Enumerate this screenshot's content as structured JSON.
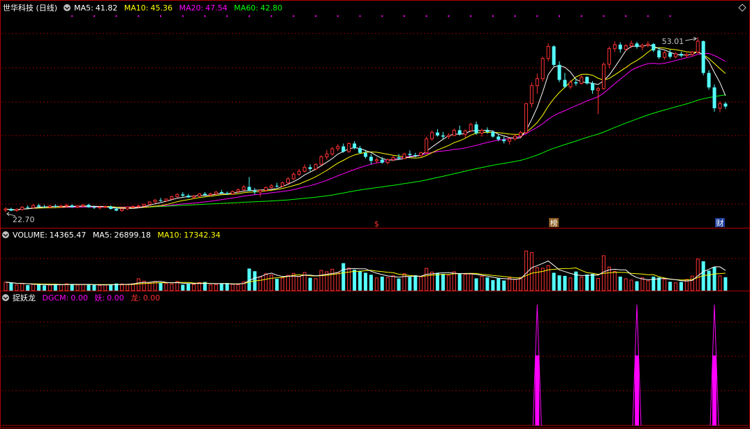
{
  "chart_data": [
    {
      "type": "candlestick",
      "panel": "price",
      "title": "世华科技 (日线)",
      "indicators": [
        {
          "label": "MA5:",
          "value": "41.82",
          "color": "#ffffff"
        },
        {
          "label": "MA10:",
          "value": "45.36",
          "color": "#ffff00"
        },
        {
          "label": "MA20:",
          "value": "47.54",
          "color": "#ff00ff"
        },
        {
          "label": "MA60:",
          "value": "42.80",
          "color": "#00ff00"
        }
      ],
      "ylim": [
        21,
        57
      ],
      "high_label": "53.01",
      "low_label": "22.70",
      "x_marks": [
        "$",
        "榜",
        "财"
      ],
      "candles": [
        [
          23.1,
          23.6,
          22.7,
          23.3
        ],
        [
          23.3,
          23.5,
          22.9,
          23.0
        ],
        [
          23.0,
          23.4,
          22.8,
          23.2
        ],
        [
          23.2,
          23.8,
          23.0,
          23.6
        ],
        [
          23.6,
          23.9,
          23.3,
          23.5
        ],
        [
          23.5,
          24.1,
          23.4,
          23.9
        ],
        [
          23.9,
          24.2,
          23.5,
          23.7
        ],
        [
          23.7,
          24.0,
          23.4,
          23.6
        ],
        [
          23.6,
          24.0,
          23.4,
          23.8
        ],
        [
          23.8,
          24.1,
          23.5,
          23.7
        ],
        [
          23.7,
          24.0,
          23.5,
          23.8
        ],
        [
          23.8,
          24.2,
          23.6,
          23.9
        ],
        [
          23.9,
          24.1,
          23.5,
          23.6
        ],
        [
          23.6,
          24.0,
          23.4,
          23.8
        ],
        [
          23.8,
          24.1,
          23.6,
          24.0
        ],
        [
          24.0,
          24.2,
          23.5,
          23.6
        ],
        [
          23.6,
          23.9,
          23.3,
          23.5
        ],
        [
          23.5,
          23.8,
          23.2,
          23.6
        ],
        [
          23.6,
          23.9,
          23.4,
          23.7
        ],
        [
          23.7,
          23.9,
          23.2,
          23.3
        ],
        [
          23.3,
          23.6,
          22.9,
          23.0
        ],
        [
          23.0,
          23.4,
          22.8,
          23.3
        ],
        [
          23.3,
          23.7,
          23.1,
          23.6
        ],
        [
          23.6,
          23.9,
          23.4,
          23.7
        ],
        [
          23.7,
          24.0,
          23.5,
          23.8
        ],
        [
          23.8,
          24.2,
          23.7,
          24.1
        ],
        [
          24.1,
          24.6,
          24.0,
          24.5
        ],
        [
          24.5,
          25.0,
          24.3,
          24.8
        ],
        [
          24.8,
          25.2,
          24.5,
          24.7
        ],
        [
          24.7,
          25.1,
          24.5,
          25.0
        ],
        [
          25.0,
          25.6,
          24.9,
          25.4
        ],
        [
          25.4,
          26.0,
          25.2,
          25.8
        ],
        [
          25.8,
          26.2,
          25.4,
          25.6
        ],
        [
          25.6,
          25.9,
          25.2,
          25.3
        ],
        [
          25.3,
          25.7,
          25.0,
          25.5
        ],
        [
          25.5,
          26.0,
          25.3,
          25.9
        ],
        [
          25.9,
          26.2,
          25.6,
          25.7
        ],
        [
          25.7,
          26.1,
          25.5,
          25.9
        ],
        [
          25.9,
          26.4,
          25.7,
          26.2
        ],
        [
          26.2,
          26.6,
          25.9,
          26.0
        ],
        [
          26.0,
          26.3,
          25.7,
          25.9
        ],
        [
          25.9,
          26.5,
          25.8,
          26.3
        ],
        [
          26.3,
          26.8,
          26.1,
          26.6
        ],
        [
          26.6,
          27.4,
          26.4,
          27.1
        ],
        [
          27.1,
          28.8,
          26.9,
          26.4
        ],
        [
          26.4,
          26.9,
          25.8,
          26.2
        ],
        [
          26.2,
          26.7,
          25.4,
          26.5
        ],
        [
          26.5,
          27.2,
          26.3,
          27.0
        ],
        [
          27.0,
          27.6,
          26.8,
          27.3
        ],
        [
          27.3,
          27.8,
          27.0,
          27.2
        ],
        [
          27.2,
          28.0,
          27.1,
          27.8
        ],
        [
          27.8,
          28.8,
          27.6,
          28.5
        ],
        [
          28.5,
          29.6,
          28.3,
          29.3
        ],
        [
          29.3,
          30.2,
          29.0,
          29.8
        ],
        [
          29.8,
          31.0,
          29.6,
          30.5
        ],
        [
          30.5,
          31.0,
          29.8,
          30.2
        ],
        [
          30.2,
          31.2,
          30.0,
          31.0
        ],
        [
          31.0,
          32.6,
          30.8,
          32.3
        ],
        [
          32.3,
          33.5,
          31.8,
          32.8
        ],
        [
          32.8,
          34.0,
          32.5,
          33.7
        ],
        [
          33.7,
          34.5,
          33.3,
          34.1
        ],
        [
          34.1,
          34.6,
          33.0,
          33.2
        ],
        [
          33.2,
          34.8,
          33.0,
          34.6
        ],
        [
          34.6,
          35.0,
          33.6,
          33.8
        ],
        [
          33.8,
          34.2,
          32.8,
          33.0
        ],
        [
          33.0,
          33.5,
          32.0,
          32.3
        ],
        [
          32.3,
          32.8,
          31.0,
          31.6
        ],
        [
          31.6,
          32.2,
          31.2,
          31.8
        ],
        [
          31.8,
          32.3,
          31.1,
          31.3
        ],
        [
          31.3,
          32.0,
          31.0,
          31.8
        ],
        [
          31.8,
          32.5,
          31.5,
          32.2
        ],
        [
          32.2,
          32.8,
          31.8,
          32.0
        ],
        [
          32.0,
          33.0,
          31.9,
          32.8
        ],
        [
          32.8,
          33.4,
          32.3,
          32.6
        ],
        [
          32.6,
          33.0,
          32.2,
          32.5
        ],
        [
          32.5,
          33.2,
          32.3,
          33.0
        ],
        [
          33.0,
          35.8,
          32.9,
          35.4
        ],
        [
          35.4,
          36.9,
          35.1,
          36.5
        ],
        [
          36.5,
          37.1,
          35.8,
          36.0
        ],
        [
          36.0,
          36.6,
          35.4,
          35.8
        ],
        [
          35.8,
          36.4,
          35.4,
          36.0
        ],
        [
          36.0,
          37.2,
          35.9,
          36.9
        ],
        [
          36.9,
          37.7,
          36.0,
          36.2
        ],
        [
          36.2,
          37.0,
          35.6,
          36.8
        ],
        [
          36.8,
          38.2,
          36.6,
          37.9
        ],
        [
          37.9,
          38.4,
          36.1,
          36.4
        ],
        [
          36.4,
          37.2,
          35.8,
          36.9
        ],
        [
          36.9,
          37.4,
          36.3,
          36.6
        ],
        [
          36.6,
          36.9,
          35.6,
          35.8
        ],
        [
          35.8,
          36.2,
          35.0,
          35.3
        ],
        [
          35.3,
          35.8,
          34.6,
          35.0
        ],
        [
          35.0,
          35.6,
          34.4,
          35.4
        ],
        [
          35.4,
          36.2,
          35.1,
          35.9
        ],
        [
          35.9,
          36.8,
          35.7,
          36.5
        ],
        [
          36.5,
          38.5,
          36.4,
          41.5
        ],
        [
          41.5,
          45.2,
          40.8,
          44.6
        ],
        [
          44.6,
          46.7,
          43.2,
          45.8
        ],
        [
          45.8,
          49.6,
          45.3,
          49.3
        ],
        [
          49.3,
          51.9,
          48.8,
          51.4
        ],
        [
          51.4,
          51.6,
          47.8,
          48.2
        ],
        [
          48.2,
          48.8,
          45.2,
          45.6
        ],
        [
          45.6,
          46.8,
          44.2,
          44.4
        ],
        [
          44.4,
          45.6,
          44.0,
          45.2
        ],
        [
          45.2,
          45.8,
          44.6,
          45.0
        ],
        [
          45.0,
          46.4,
          44.8,
          46.1
        ],
        [
          46.1,
          46.3,
          44.8,
          45.0
        ],
        [
          45.0,
          45.4,
          43.2,
          43.8
        ],
        [
          43.8,
          44.4,
          39.7,
          44.1
        ],
        [
          44.1,
          48.6,
          43.9,
          48.3
        ],
        [
          48.3,
          51.4,
          47.6,
          51.0
        ],
        [
          51.0,
          52.3,
          50.4,
          51.7
        ],
        [
          51.7,
          52.1,
          50.3,
          50.9
        ],
        [
          50.9,
          51.8,
          50.6,
          51.5
        ],
        [
          51.5,
          52.4,
          51.1,
          51.9
        ],
        [
          51.9,
          52.2,
          51.0,
          51.3
        ],
        [
          51.3,
          51.9,
          50.7,
          51.6
        ],
        [
          51.6,
          52.3,
          51.2,
          51.8
        ],
        [
          51.8,
          52.0,
          50.4,
          50.7
        ],
        [
          50.7,
          51.2,
          49.2,
          49.5
        ],
        [
          49.5,
          50.6,
          49.1,
          50.3
        ],
        [
          50.3,
          50.8,
          49.3,
          49.6
        ],
        [
          49.6,
          50.4,
          49.3,
          50.1
        ],
        [
          50.1,
          50.5,
          49.5,
          49.8
        ],
        [
          49.8,
          50.3,
          49.4,
          50.0
        ],
        [
          50.0,
          50.6,
          49.7,
          50.4
        ],
        [
          50.4,
          53.0,
          50.1,
          52.3
        ],
        [
          52.3,
          52.4,
          46.4,
          46.8
        ],
        [
          46.8,
          47.3,
          43.9,
          44.3
        ],
        [
          44.3,
          44.8,
          40.1,
          40.7
        ],
        [
          40.7,
          41.9,
          40.0,
          41.5
        ],
        [
          41.5,
          41.8,
          40.6,
          41.0
        ]
      ]
    },
    {
      "type": "bar",
      "panel": "volume",
      "title": "VOLUME",
      "indicators": [
        {
          "label": "VOLUME:",
          "value": "14365.47",
          "color": "#ffffff"
        },
        {
          "label": "MA5:",
          "value": "26899.18",
          "color": "#ffffff"
        },
        {
          "label": "MA10:",
          "value": "17342.34",
          "color": "#ffff00"
        }
      ],
      "ylim": [
        0,
        48000
      ],
      "values": [
        8200,
        7400,
        5600,
        6800,
        5400,
        6100,
        5900,
        5200,
        5600,
        6300,
        5800,
        6700,
        6200,
        5500,
        5900,
        6100,
        5400,
        5100,
        5600,
        6200,
        6900,
        6400,
        5800,
        6800,
        11500,
        9200,
        7400,
        9000,
        7800,
        6900,
        6300,
        8900,
        5800,
        6600,
        6100,
        7800,
        8400,
        5600,
        6000,
        6700,
        7300,
        6200,
        5800,
        8500,
        21400,
        18800,
        13200,
        16400,
        15200,
        11500,
        12300,
        14800,
        16700,
        13600,
        17600,
        12400,
        11600,
        19600,
        18300,
        20800,
        17500,
        26600,
        21900,
        20300,
        19200,
        17300,
        15400,
        12300,
        13600,
        12800,
        14400,
        11700,
        16400,
        13200,
        14900,
        13400,
        21600,
        18000,
        16900,
        16200,
        14800,
        18300,
        16600,
        15800,
        16100,
        11900,
        13800,
        12800,
        10200,
        11800,
        9800,
        12200,
        10700,
        12800,
        38400,
        36800,
        22300,
        21700,
        24300,
        17300,
        14800,
        14300,
        12300,
        18500,
        13200,
        15600,
        16200,
        11800,
        33800,
        22900,
        18600,
        13600,
        11500,
        10300,
        9100,
        12400,
        9600,
        13600,
        12700,
        10900,
        8600,
        7600,
        8400,
        10800,
        14100,
        30600,
        28400,
        19400,
        22700,
        14300,
        13000
      ]
    },
    {
      "type": "bar",
      "panel": "indicator",
      "title": "捉妖龙",
      "indicators": [
        {
          "label": "捉妖龙",
          "value": "",
          "color": "#ffffff"
        },
        {
          "label": "DGCM:",
          "value": "0.00",
          "color": "#ff00ff"
        },
        {
          "label": "妖:",
          "value": "0.00",
          "color": "#ff00ff"
        },
        {
          "label": "龙:",
          "value": "0.00",
          "color": "#ff3030"
        }
      ],
      "ylim": [
        0,
        1
      ],
      "spikes": [
        {
          "index": 96,
          "peak": 1.0,
          "fill": 0.58
        },
        {
          "index": 114,
          "peak": 1.0,
          "fill": 0.58
        },
        {
          "index": 128,
          "peak": 1.0,
          "fill": 0.58
        }
      ]
    }
  ],
  "colors": {
    "up": "#ff3333",
    "down": "#54ffff",
    "grid": "#8b0000",
    "frame": "#b00000",
    "ma5": "#ffffff",
    "ma10": "#ffff00",
    "ma20": "#ff00ff",
    "ma60": "#00ff00",
    "spike": "#ff00ff"
  },
  "icons": {
    "dropdown": "circle-chevron-down-icon",
    "corner": "diamond-icon"
  }
}
